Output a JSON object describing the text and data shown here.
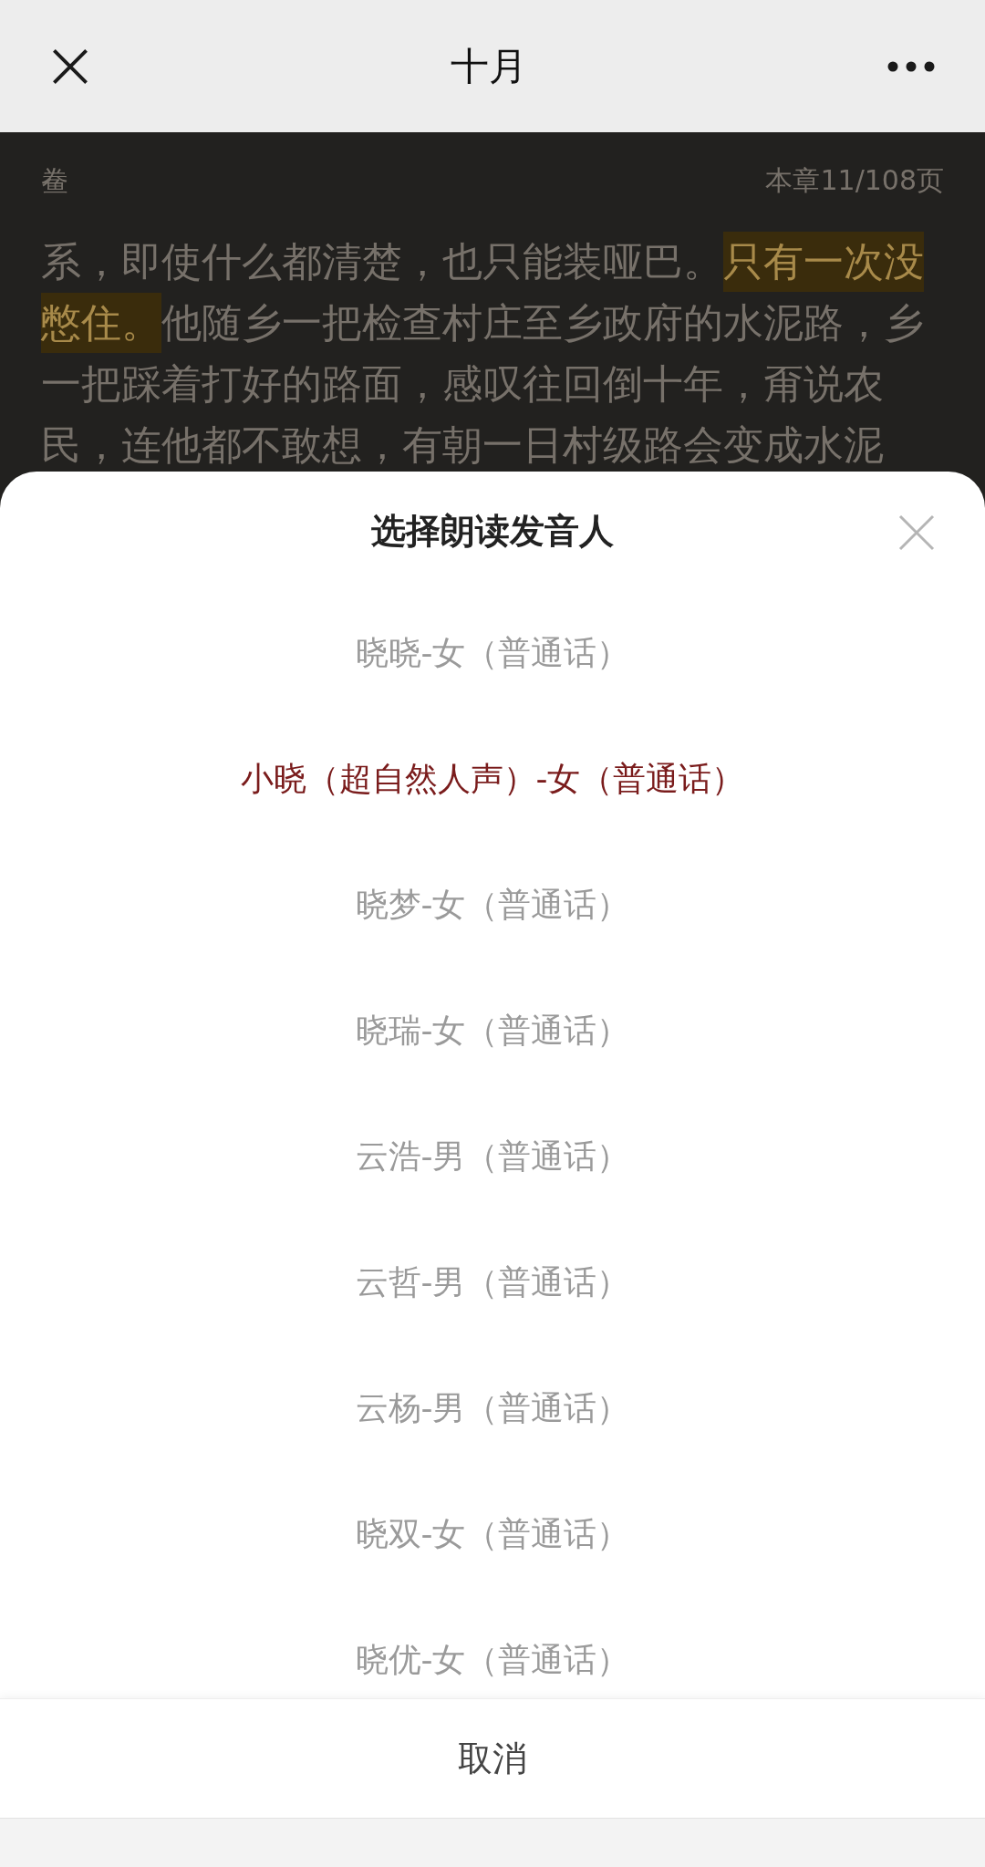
{
  "header": {
    "title": "十月"
  },
  "reader": {
    "chapter_mark": "鲞",
    "page_info": "本章11/108页",
    "lines": [
      [
        {
          "text": "系，即使什么都清楚，也只能装哑巴。",
          "highlighted": false
        },
        {
          "text": "只有一次没",
          "highlighted": true
        }
      ],
      [
        {
          "text": "憋住。",
          "highlighted": true
        },
        {
          "text": "他随乡一把检查村庄至乡政府的水泥路，乡",
          "highlighted": false
        }
      ],
      [
        {
          "text": "一把踩着打好的路面，感叹往回倒十年，甭说农",
          "highlighted": false
        }
      ],
      [
        {
          "text": "民，连他都不敢想，有朝一日村级路会变成水泥",
          "highlighted": false
        }
      ]
    ]
  },
  "sheet": {
    "title": "选择朗读发音人",
    "voices": [
      {
        "label": "晓晓-女（普通话）",
        "selected": false
      },
      {
        "label": "小晓（超自然人声）-女（普通话）",
        "selected": true
      },
      {
        "label": "晓梦-女（普通话）",
        "selected": false
      },
      {
        "label": "晓瑞-女（普通话）",
        "selected": false
      },
      {
        "label": "云浩-男（普通话）",
        "selected": false
      },
      {
        "label": "云哲-男（普通话）",
        "selected": false
      },
      {
        "label": "云杨-男（普通话）",
        "selected": false
      },
      {
        "label": "晓双-女（普通话）",
        "selected": false
      },
      {
        "label": "晓优-女（普通话）",
        "selected": false
      }
    ],
    "cancel": "取消"
  }
}
